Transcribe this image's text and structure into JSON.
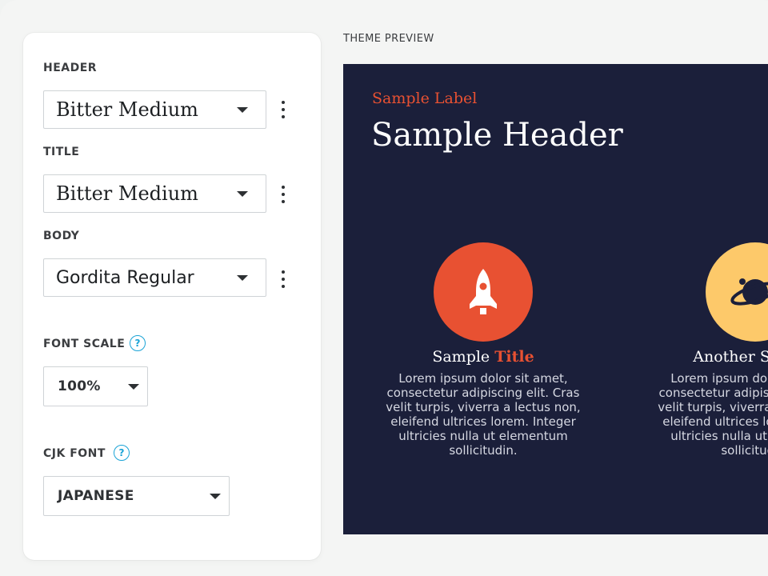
{
  "panel": {
    "header": {
      "label": "HEADER",
      "value": "Bitter Medium"
    },
    "title": {
      "label": "TITLE",
      "value": "Bitter Medium"
    },
    "body": {
      "label": "BODY",
      "value": "Gordita Regular"
    },
    "font_scale": {
      "label": "FONT SCALE",
      "value": "100%",
      "help": "?"
    },
    "cjk_font": {
      "label": "CJK FONT",
      "value": "JAPANESE",
      "help": "?"
    }
  },
  "preview": {
    "heading": "THEME PREVIEW",
    "sample_label": "Sample Label",
    "sample_header": "Sample Header",
    "features": [
      {
        "icon": "rocket-icon",
        "title_plain": "Sample ",
        "title_accent": "Title",
        "body": "Lorem ipsum dolor sit amet, consectetur adipiscing elit. Cras velit turpis, viverra a lectus non, eleifend ultrices lorem. Integer ultricies nulla ut elementum sollicitudin."
      },
      {
        "icon": "planet-icon",
        "title_plain": "Another Sample",
        "title_accent": "",
        "body": "Lorem ipsum dolor sit amet, consectetur adipiscing elit. Cras velit turpis, viverra a lectus non, eleifend ultrices lorem. Integer ultricies nulla ut elementum sollicitudin."
      }
    ]
  },
  "colors": {
    "accent": "#e85132",
    "preview_bg": "#1b1f3a",
    "help_blue": "#1aa3d6",
    "planet_yellow": "#fdc96a"
  }
}
